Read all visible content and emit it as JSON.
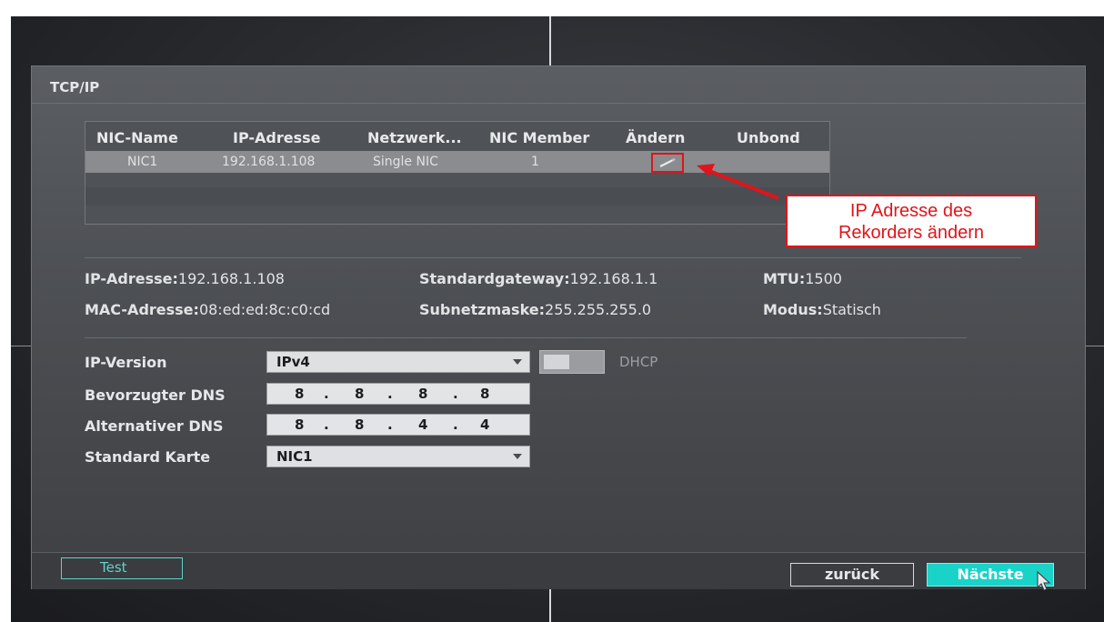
{
  "caption": "",
  "dialog": {
    "title": "TCP/IP"
  },
  "nic_table": {
    "columns": [
      "NIC-Name",
      "IP-Adresse",
      "Netzwerk...",
      "NIC Member",
      "Ändern",
      "Unbond"
    ],
    "rows": [
      {
        "nic_name": "NIC1",
        "ip": "192.168.1.108",
        "network": "Single NIC",
        "member": "1"
      }
    ]
  },
  "info": {
    "ip_label": "IP-Adresse:",
    "ip_value": "192.168.1.108",
    "mac_label": "MAC-Adresse:",
    "mac_value": "08:ed:ed:8c:c0:cd",
    "gw_label": "Standardgateway:",
    "gw_value": "192.168.1.1",
    "mask_label": "Subnetzmaske:",
    "mask_value": "255.255.255.0",
    "mtu_label": "MTU:",
    "mtu_value": "1500",
    "mode_label": "Modus:",
    "mode_value": "Statisch"
  },
  "form": {
    "ip_version_label": "IP-Version",
    "ip_version_value": "IPv4",
    "dhcp_label": "DHCP",
    "preferred_dns_label": "Bevorzugter DNS",
    "preferred_dns": [
      "8",
      "8",
      "8",
      "8"
    ],
    "alternate_dns_label": "Alternativer DNS",
    "alternate_dns": [
      "8",
      "8",
      "4",
      "4"
    ],
    "default_card_label": "Standard Karte",
    "default_card_value": "NIC1"
  },
  "footer": {
    "test_label": "Test",
    "back_label": "zurück",
    "next_label": "Nächste"
  },
  "annotation": {
    "line1": "IP Adresse des",
    "line2": "Rekorders ändern",
    "color": "#e0141a"
  }
}
